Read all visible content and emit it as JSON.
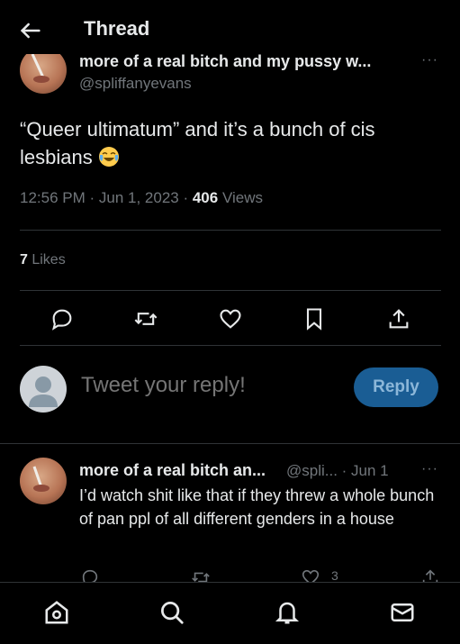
{
  "header": {
    "title": "Thread"
  },
  "main_tweet": {
    "author_name": "more of a real bitch and my pussy w...",
    "author_handle": "@spliffanyevans",
    "text": "“Queer ultimatum” and it’s a bunch of cis lesbians",
    "emoji": "face-with-tears-of-joy",
    "time": "12:56 PM · Jun 1, 2023 · ",
    "views_count": "406",
    "views_label": " Views",
    "likes_count": "7",
    "likes_label": " Likes"
  },
  "reply_box": {
    "placeholder": "Tweet your reply!",
    "button_label": "Reply"
  },
  "reply_tweet": {
    "author_name": "more of a real bitch an...",
    "handle_and_date": "@spli... · Jun 1",
    "text": "I’d watch shit like that if they threw a whole bunch of pan ppl of all different genders in a house",
    "like_count": "3"
  },
  "colors": {
    "background": "#000000",
    "text": "#e7e9ea",
    "muted": "#71767b",
    "divider": "#2f3336",
    "reply_button": "#1a5d94"
  },
  "icons": {
    "back": "arrow-left-icon",
    "more": "more-horizontal-icon",
    "reply": "reply-bubble-icon",
    "retweet": "retweet-icon",
    "like": "heart-icon",
    "bookmark": "bookmark-icon",
    "share": "share-icon",
    "nav": [
      "home-icon",
      "search-icon",
      "notifications-icon",
      "messages-icon"
    ]
  }
}
